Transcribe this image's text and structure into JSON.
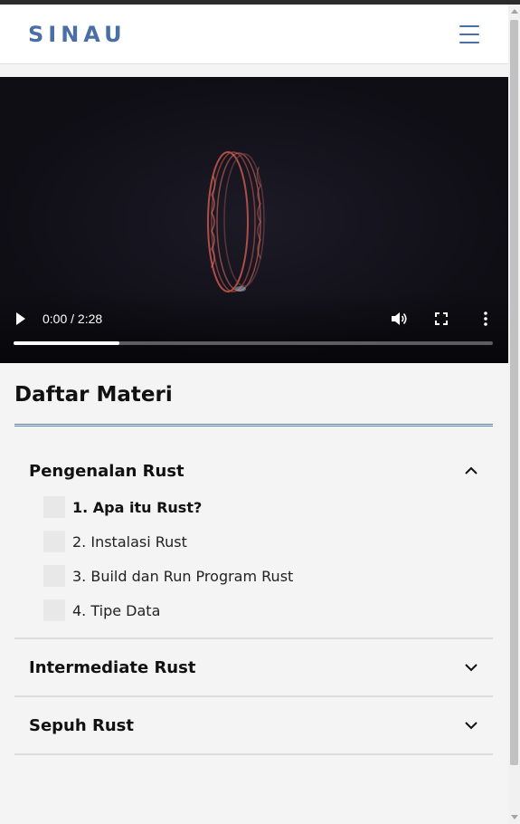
{
  "brand": {
    "logo": "SINAU",
    "accent_color": "#4a6fa5"
  },
  "header": {
    "menu_icon": "hamburger-menu-icon"
  },
  "video": {
    "current_time": "0:00",
    "duration": "2:28",
    "time_display": "0:00 / 2:28",
    "progress_fraction": 0.22,
    "icons": [
      "play-icon",
      "volume-icon",
      "fullscreen-icon",
      "more-options-icon"
    ]
  },
  "materials": {
    "title": "Daftar Materi",
    "sections": [
      {
        "title": "Pengenalan Rust",
        "expanded": true,
        "lessons": [
          {
            "label": "1. Apa itu Rust?",
            "active": true
          },
          {
            "label": "2. Instalasi Rust",
            "active": false
          },
          {
            "label": "3. Build dan Run Program Rust",
            "active": false
          },
          {
            "label": "4. Tipe Data",
            "active": false
          }
        ]
      },
      {
        "title": "Intermediate Rust",
        "expanded": false
      },
      {
        "title": "Sepuh Rust",
        "expanded": false
      }
    ]
  }
}
